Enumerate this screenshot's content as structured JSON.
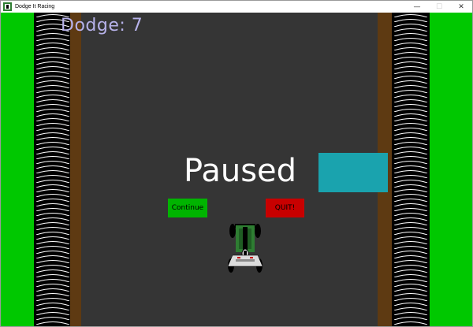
{
  "window": {
    "title": "Dodge It Racing",
    "controls": {
      "minimize": "—",
      "maximize": "☐",
      "close": "✕"
    }
  },
  "hud": {
    "score_label": "Dodge: 7"
  },
  "pause_menu": {
    "title": "Paused",
    "continue_label": "Continue",
    "quit_label": "QUIT!"
  },
  "colors": {
    "grass": "#00c800",
    "road": "#353535",
    "curb": "#5e3a12",
    "obstacle": "#1aa3ae",
    "continue_button": "#00b400",
    "quit_button": "#c80000",
    "score_text": "#b7b2ea",
    "car_body": "#2e7d32"
  },
  "icons": {
    "app": "app-icon",
    "player": "race-car-icon"
  }
}
